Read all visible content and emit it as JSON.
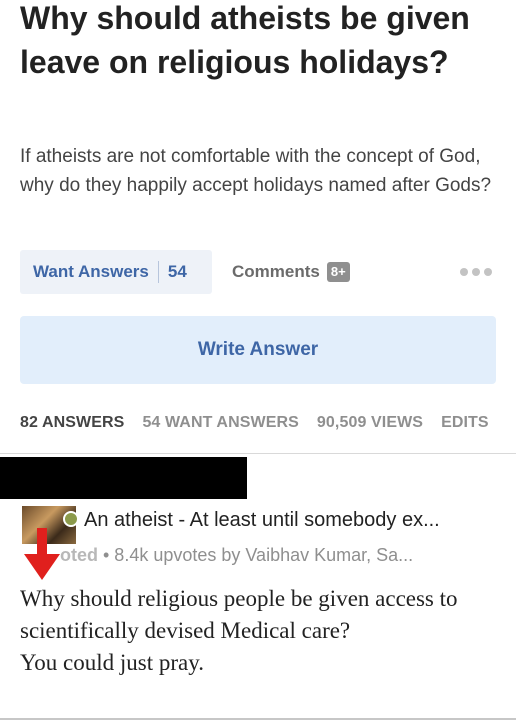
{
  "question": {
    "title": "Why should atheists be given leave on religious holidays?",
    "details": "If atheists are not comfortable with the concept of God, why do they happily accept holidays named after Gods?"
  },
  "actions": {
    "want_answers_label": "Want Answers",
    "want_answers_count": "54",
    "comments_label": "Comments",
    "comments_badge": "8+",
    "write_answer_label": "Write Answer"
  },
  "stats": {
    "answers": "82 ANSWERS",
    "want_answers": "54 WANT ANSWERS",
    "views": "90,509 VIEWS",
    "edits": "EDITS"
  },
  "answer": {
    "author_line": "An atheist - At least until somebody ex...",
    "voted_prefix": "oted",
    "meta": " • 8.4k upvotes by Vaibhav Kumar, Sa...",
    "body_line1": "Why should religious people be given access to scientifically devised Medical care?",
    "body_line2": "You could just pray."
  },
  "icons": {
    "more": "more-dots-icon",
    "arrow": "red-down-arrow-icon",
    "verified": "verified-badge-icon"
  },
  "colors": {
    "link_blue": "#3e66a6",
    "button_bg": "#eef2f8",
    "write_bg": "#e2eefb",
    "muted_gray": "#8f8f8f",
    "arrow_red": "#e0201d"
  }
}
